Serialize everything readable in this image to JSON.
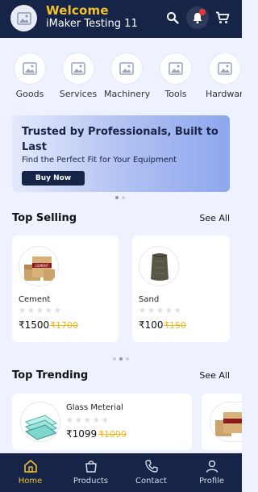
{
  "header": {
    "welcome": "Welcome",
    "company": "iMaker Testing 11"
  },
  "categories": [
    {
      "label": "Goods"
    },
    {
      "label": "Services"
    },
    {
      "label": "Machinery"
    },
    {
      "label": "Tools"
    },
    {
      "label": "Hardware"
    }
  ],
  "banner": {
    "title": "Trusted by Professionals, Built to Last",
    "subtitle": "Find the Perfect Fit for Your Equipment",
    "button": "Buy Now"
  },
  "top_selling": {
    "title": "Top Selling",
    "see_all": "See All",
    "products": [
      {
        "name": "Cement",
        "price": "₹1500",
        "old_price": "₹1700"
      },
      {
        "name": "Sand",
        "price": "₹100",
        "old_price": "₹150"
      }
    ]
  },
  "top_trending": {
    "title": "Top Trending",
    "see_all": "See All",
    "products": [
      {
        "name": "Glass Meterial",
        "price": "₹1099",
        "old_price": "₹1099"
      }
    ]
  },
  "nav": [
    {
      "label": "Home",
      "icon": "home-icon",
      "active": true
    },
    {
      "label": "Products",
      "icon": "bag-icon"
    },
    {
      "label": "Contact",
      "icon": "phone-icon"
    },
    {
      "label": "Profile",
      "icon": "person-icon"
    }
  ],
  "colors": {
    "header_bg": "#152447",
    "accent": "#f2c230",
    "page_bg": "#eef2ff"
  }
}
